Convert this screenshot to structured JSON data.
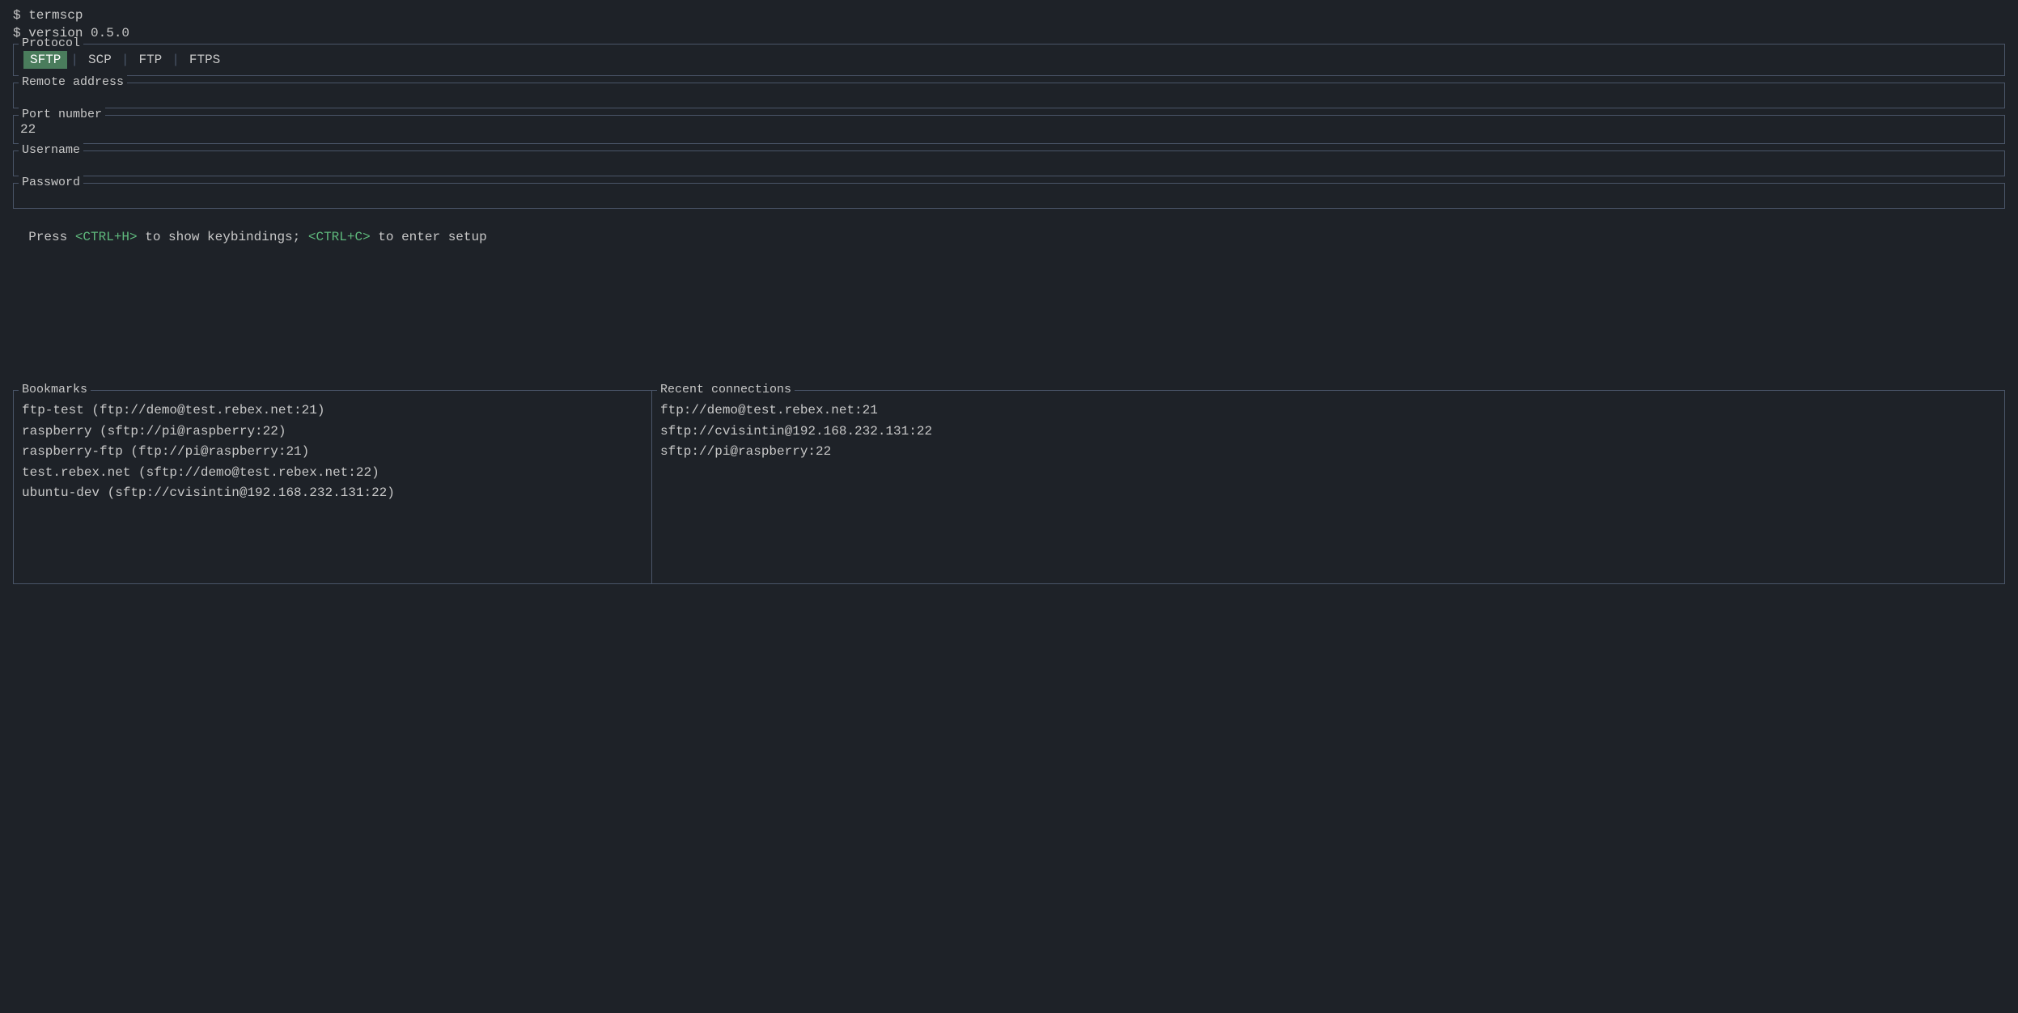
{
  "header": {
    "command": "$ termscp",
    "version": "$ version 0.5.0"
  },
  "protocol": {
    "legend": "Protocol",
    "tabs": [
      "SFTP",
      "SCP",
      "FTP",
      "FTPS"
    ],
    "active": "SFTP"
  },
  "remote_address": {
    "legend": "Remote address",
    "value": "",
    "placeholder": ""
  },
  "port_number": {
    "legend": "Port number",
    "value": "22"
  },
  "username": {
    "legend": "Username",
    "value": "",
    "placeholder": ""
  },
  "password": {
    "legend": "Password",
    "value": "",
    "placeholder": ""
  },
  "help_text": {
    "prefix": "Press ",
    "ctrl_h": "<CTRL+H>",
    "middle": " to show keybindings; ",
    "ctrl_c": "<CTRL+C>",
    "suffix": " to enter setup"
  },
  "bookmarks": {
    "legend": "Bookmarks",
    "items": [
      "ftp-test (ftp://demo@test.rebex.net:21)",
      "raspberry (sftp://pi@raspberry:22)",
      "raspberry-ftp (ftp://pi@raspberry:21)",
      "test.rebex.net (sftp://demo@test.rebex.net:22)",
      "ubuntu-dev (sftp://cvisintin@192.168.232.131:22)"
    ]
  },
  "recent_connections": {
    "legend": "Recent connections",
    "items": [
      "ftp://demo@test.rebex.net:21",
      "sftp://cvisintin@192.168.232.131:22",
      "sftp://pi@raspberry:22"
    ]
  }
}
